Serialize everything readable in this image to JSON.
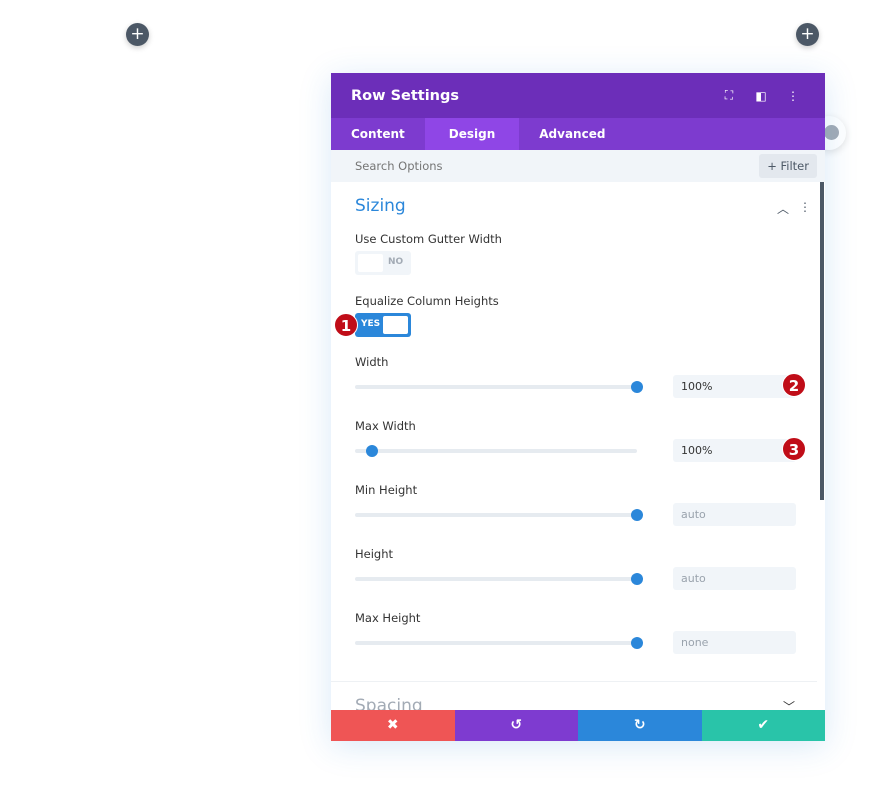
{
  "canvas": {
    "add_buttons": [
      {
        "icon": "plus-icon",
        "label": "+"
      },
      {
        "icon": "plus-icon",
        "label": "+"
      }
    ]
  },
  "modal": {
    "title": "Row Settings",
    "header_icons": [
      "fullscreen-icon",
      "sidebar-layout-icon",
      "more-vertical-icon"
    ],
    "tabs": [
      {
        "label": "Content",
        "active": false
      },
      {
        "label": "Design",
        "active": true
      },
      {
        "label": "Advanced",
        "active": false
      }
    ],
    "search": {
      "placeholder": "Search Options",
      "value": ""
    },
    "filter_label": "+ Filter",
    "section": {
      "title": "Sizing",
      "expanded": true
    },
    "gutter": {
      "label": "Use Custom Gutter Width",
      "toggle": "NO",
      "on": false
    },
    "equalize": {
      "label": "Equalize Column Heights",
      "toggle": "YES",
      "on": true
    },
    "sliders": [
      {
        "label": "Width",
        "value": "100%",
        "placeholder": false,
        "level": 1.0
      },
      {
        "label": "Max Width",
        "value": "100%",
        "placeholder": false,
        "level": 0.06
      },
      {
        "label": "Min Height",
        "value": "auto",
        "placeholder": true,
        "level": 1.0
      },
      {
        "label": "Height",
        "value": "auto",
        "placeholder": true,
        "level": 1.0
      },
      {
        "label": "Max Height",
        "value": "none",
        "placeholder": true,
        "level": 1.0
      }
    ],
    "badges": [
      "1",
      "2",
      "3"
    ],
    "next_section": "Spacing",
    "footer": [
      {
        "name": "cancel",
        "icon": "✖",
        "color": "#ef5555"
      },
      {
        "name": "undo",
        "icon": "↺",
        "color": "#7e3bd0"
      },
      {
        "name": "redo",
        "icon": "↻",
        "color": "#2b87da"
      },
      {
        "name": "save",
        "icon": "✔",
        "color": "#29c4a9"
      }
    ]
  },
  "colors": {
    "header": "#6c2eb9",
    "tabs": "#7d3bcf",
    "accent": "#2b87da",
    "badge": "#c00d18"
  }
}
